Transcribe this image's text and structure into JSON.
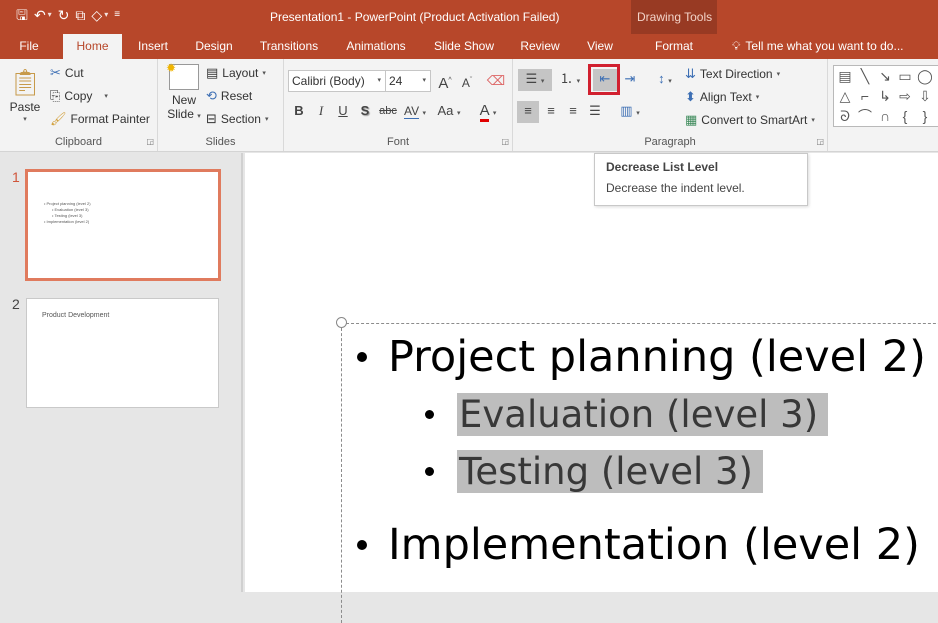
{
  "titlebar": {
    "title": "Presentation1 - PowerPoint (Product Activation Failed)",
    "context_group": "Drawing Tools",
    "qat": [
      {
        "icon": "save-icon",
        "glyph": "🖫"
      },
      {
        "icon": "undo-icon",
        "glyph": "↶"
      },
      {
        "icon": "redo-icon",
        "glyph": "↻"
      },
      {
        "icon": "start-from-beginning-icon",
        "glyph": "⧉"
      },
      {
        "icon": "shape-fill-icon",
        "glyph": "◇"
      },
      {
        "icon": "customize-qat-icon",
        "glyph": "≡"
      }
    ]
  },
  "tabs": [
    {
      "label": "File"
    },
    {
      "label": "Home",
      "active": true
    },
    {
      "label": "Insert"
    },
    {
      "label": "Design"
    },
    {
      "label": "Transitions"
    },
    {
      "label": "Animations"
    },
    {
      "label": "Slide Show"
    },
    {
      "label": "Review"
    },
    {
      "label": "View"
    },
    {
      "label": "Format",
      "contextual": true
    }
  ],
  "tell_me": {
    "icon": "lightbulb-icon",
    "glyph": "♀",
    "label": "Tell me what you want to do..."
  },
  "ribbon": {
    "clipboard": {
      "label": "Clipboard",
      "paste": "Paste",
      "cut": "Cut",
      "copy": "Copy",
      "format_painter": "Format Painter"
    },
    "slides": {
      "label": "Slides",
      "new_slide_line1": "New",
      "new_slide_line2": "Slide",
      "layout": "Layout",
      "reset": "Reset",
      "section": "Section"
    },
    "font": {
      "label": "Font",
      "font_name": "Calibri (Body)",
      "font_size": "24",
      "grow": "A",
      "shrink": "A",
      "bold": "B",
      "italic": "I",
      "underline": "U",
      "shadow": "S",
      "strikethrough": "abc",
      "spacing": "AV",
      "change_case": "Aa",
      "font_color": "A",
      "font_color_hex": "#e00000"
    },
    "paragraph": {
      "label": "Paragraph",
      "text_direction": "Text Direction",
      "align_text": "Align Text",
      "convert_smartart": "Convert to SmartArt"
    }
  },
  "tooltip": {
    "title": "Decrease List Level",
    "description": "Decrease the indent level."
  },
  "slides": [
    {
      "number": "1",
      "active": true,
      "thumb_lines": [
        {
          "text": "• Project planning (level 2)",
          "level": 2
        },
        {
          "text": "• Evaluation (level 3)",
          "level": 3
        },
        {
          "text": "• Testing (level 3)",
          "level": 3
        },
        {
          "text": "• Implementation (level 2)",
          "level": 2
        }
      ]
    },
    {
      "number": "2",
      "active": false,
      "thumb_title": "Product Development"
    }
  ],
  "slide_content": {
    "lines": [
      {
        "text": "Project planning (level 2)",
        "level": 2,
        "selected": false
      },
      {
        "text": "Evaluation (level 3)",
        "level": 3,
        "selected": true
      },
      {
        "text": "Testing (level 3)",
        "level": 3,
        "selected": true
      },
      {
        "text": "Implementation (level 2)",
        "level": 2,
        "selected": false
      }
    ]
  },
  "colors": {
    "accent": "#b7472a",
    "context_tab": "#983a23",
    "highlight_box": "#d1202f",
    "selection": "#bdbdbd"
  }
}
